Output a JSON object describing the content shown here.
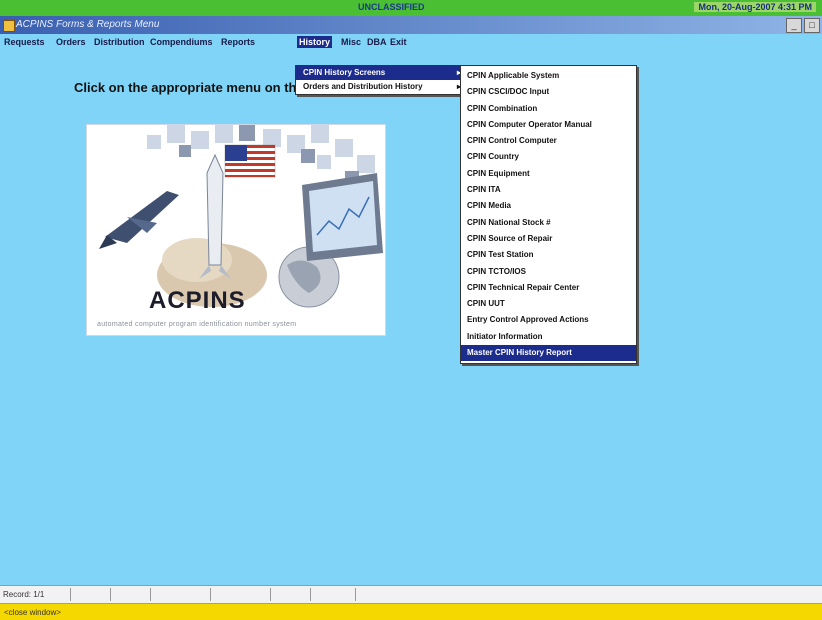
{
  "banner": {
    "classification": "UNCLASSIFIED",
    "datetime": "Mon, 20-Aug-2007 4:31 PM"
  },
  "window": {
    "title": "ACPINS Forms & Reports Menu"
  },
  "menubar": {
    "items": [
      "Requests",
      "Orders",
      "Distribution",
      "Compendiums",
      "Reports",
      "History",
      "Misc",
      "DBA",
      "Exit"
    ],
    "active": "History"
  },
  "main": {
    "instruction": "Click on the appropriate menu on th"
  },
  "splash": {
    "logo_text": "ACPINS",
    "tagline": "automated computer program identification number system"
  },
  "history_menu": {
    "items": [
      {
        "label": "CPIN History Screens",
        "arrow": "▸"
      },
      {
        "label": "Orders and Distribution History",
        "arrow": "▸"
      }
    ]
  },
  "cpin_history_menu": {
    "items": [
      "CPIN Applicable System",
      "CPIN CSCI/DOC Input",
      "CPIN Combination",
      "CPIN Computer Operator Manual",
      "CPIN Control Computer",
      "CPIN Country",
      "CPIN Equipment",
      "CPIN ITA",
      "CPIN Media",
      "CPIN National Stock #",
      "CPIN Source of Repair",
      "CPIN Test Station",
      "CPIN TCTO/IOS",
      "CPIN Technical Repair Center",
      "CPIN UUT",
      "Entry Control Approved Actions",
      "Initiator Information",
      "Master CPIN History Report"
    ],
    "highlighted": "Master CPIN History Report"
  },
  "status": {
    "record": "Record: 1/1"
  },
  "hint": {
    "text": "<close window>"
  },
  "colors": {
    "background": "#7fd4f7",
    "banner": "#4bbf34",
    "menu_highlight": "#1c2c8c",
    "hint_bar": "#f5d800"
  }
}
